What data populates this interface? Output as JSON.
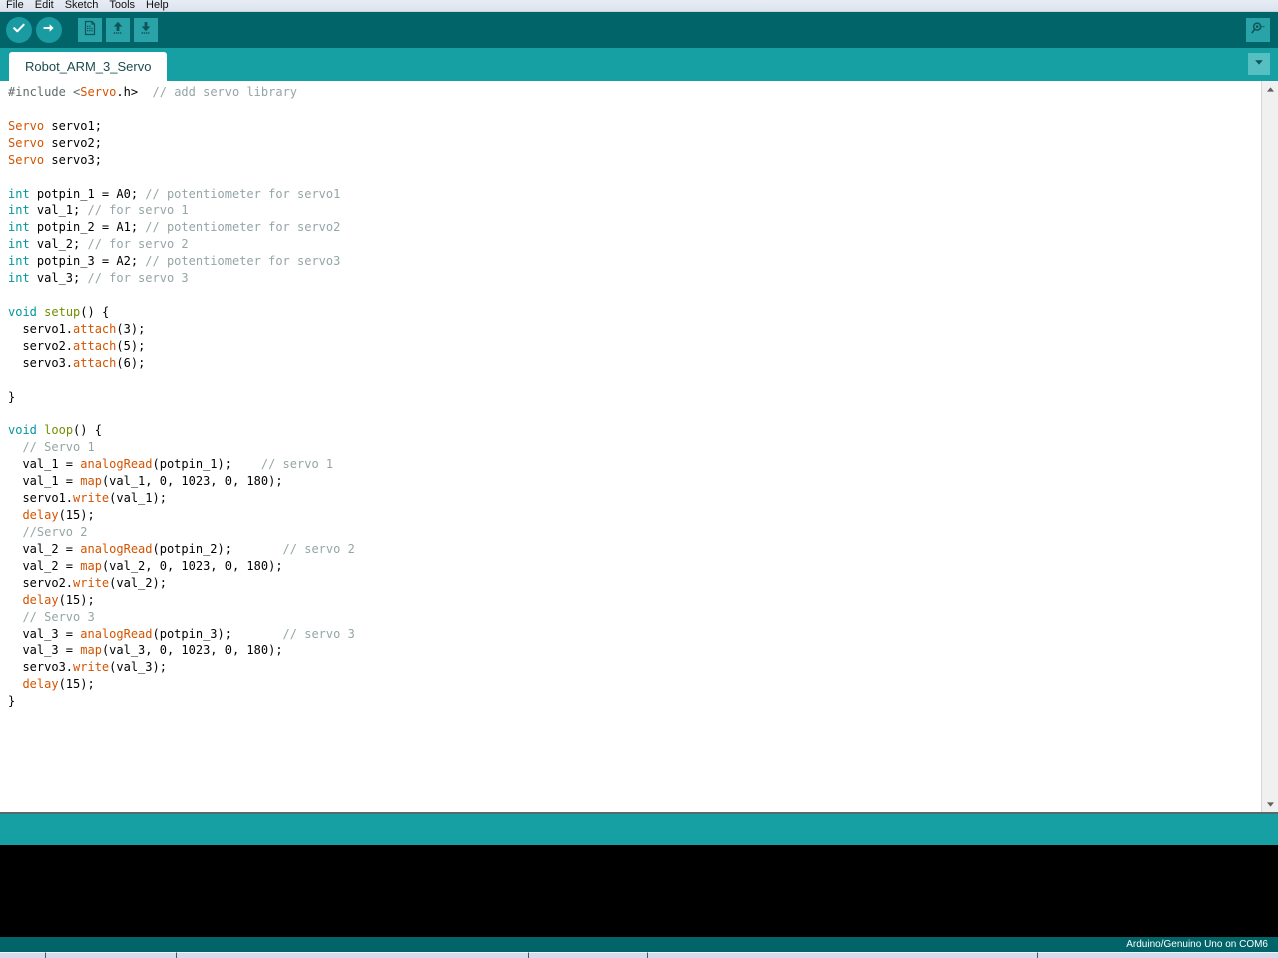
{
  "menubar": {
    "items": [
      {
        "label": "File"
      },
      {
        "label": "Edit"
      },
      {
        "label": "Sketch"
      },
      {
        "label": "Tools"
      },
      {
        "label": "Help"
      }
    ]
  },
  "toolbar": {
    "verify_label": "Verify",
    "upload_label": "Upload",
    "new_label": "New",
    "open_label": "Open",
    "save_label": "Save",
    "serial_monitor_label": "Serial Monitor"
  },
  "tabs": {
    "active": "Robot_ARM_3_Servo",
    "items": [
      {
        "label": "Robot_ARM_3_Servo"
      }
    ],
    "menu_label": "Tab Menu"
  },
  "editor": {
    "lines": [
      [
        {
          "t": "#include ",
          "c": "pp"
        },
        {
          "t": "<",
          "c": "pp"
        },
        {
          "t": "Servo",
          "c": "ty"
        },
        {
          "t": ".h>",
          "c": ""
        },
        {
          "t": "  ",
          "c": ""
        },
        {
          "t": "// add servo library",
          "c": "cm"
        }
      ],
      [],
      [
        {
          "t": "Servo",
          "c": "ty"
        },
        {
          "t": " servo1;",
          "c": ""
        }
      ],
      [
        {
          "t": "Servo",
          "c": "ty"
        },
        {
          "t": " servo2;",
          "c": ""
        }
      ],
      [
        {
          "t": "Servo",
          "c": "ty"
        },
        {
          "t": " servo3;",
          "c": ""
        }
      ],
      [],
      [
        {
          "t": "int",
          "c": "k"
        },
        {
          "t": " potpin_1 = A0; ",
          "c": ""
        },
        {
          "t": "// potentiometer for servo1",
          "c": "cm"
        }
      ],
      [
        {
          "t": "int",
          "c": "k"
        },
        {
          "t": " val_1; ",
          "c": ""
        },
        {
          "t": "// for servo 1",
          "c": "cm"
        }
      ],
      [
        {
          "t": "int",
          "c": "k"
        },
        {
          "t": " potpin_2 = A1; ",
          "c": ""
        },
        {
          "t": "// potentiometer for servo2",
          "c": "cm"
        }
      ],
      [
        {
          "t": "int",
          "c": "k"
        },
        {
          "t": " val_2; ",
          "c": ""
        },
        {
          "t": "// for servo 2",
          "c": "cm"
        }
      ],
      [
        {
          "t": "int",
          "c": "k"
        },
        {
          "t": " potpin_3 = A2; ",
          "c": ""
        },
        {
          "t": "// potentiometer for servo3",
          "c": "cm"
        }
      ],
      [
        {
          "t": "int",
          "c": "k"
        },
        {
          "t": " val_3; ",
          "c": ""
        },
        {
          "t": "// for servo 3",
          "c": "cm"
        }
      ],
      [],
      [
        {
          "t": "void",
          "c": "k"
        },
        {
          "t": " ",
          "c": ""
        },
        {
          "t": "setup",
          "c": "sf"
        },
        {
          "t": "() {",
          "c": ""
        }
      ],
      [
        {
          "t": "  servo1.",
          "c": ""
        },
        {
          "t": "attach",
          "c": "fn"
        },
        {
          "t": "(3);",
          "c": ""
        }
      ],
      [
        {
          "t": "  servo2.",
          "c": ""
        },
        {
          "t": "attach",
          "c": "fn"
        },
        {
          "t": "(5);",
          "c": ""
        }
      ],
      [
        {
          "t": "  servo3.",
          "c": ""
        },
        {
          "t": "attach",
          "c": "fn"
        },
        {
          "t": "(6);",
          "c": ""
        }
      ],
      [],
      [
        {
          "t": "}",
          "c": ""
        }
      ],
      [],
      [
        {
          "t": "void",
          "c": "k"
        },
        {
          "t": " ",
          "c": ""
        },
        {
          "t": "loop",
          "c": "sf"
        },
        {
          "t": "() {",
          "c": ""
        }
      ],
      [
        {
          "t": "  ",
          "c": ""
        },
        {
          "t": "// Servo 1",
          "c": "cm"
        }
      ],
      [
        {
          "t": "  val_1 = ",
          "c": ""
        },
        {
          "t": "analogRead",
          "c": "fn"
        },
        {
          "t": "(potpin_1);    ",
          "c": ""
        },
        {
          "t": "// servo 1",
          "c": "cm"
        }
      ],
      [
        {
          "t": "  val_1 = ",
          "c": ""
        },
        {
          "t": "map",
          "c": "fn"
        },
        {
          "t": "(val_1, 0, 1023, 0, 180);",
          "c": ""
        }
      ],
      [
        {
          "t": "  servo1.",
          "c": ""
        },
        {
          "t": "write",
          "c": "fn"
        },
        {
          "t": "(val_1);",
          "c": ""
        }
      ],
      [
        {
          "t": "  ",
          "c": ""
        },
        {
          "t": "delay",
          "c": "fn"
        },
        {
          "t": "(15);",
          "c": ""
        }
      ],
      [
        {
          "t": "  ",
          "c": ""
        },
        {
          "t": "//Servo 2",
          "c": "cm"
        }
      ],
      [
        {
          "t": "  val_2 = ",
          "c": ""
        },
        {
          "t": "analogRead",
          "c": "fn"
        },
        {
          "t": "(potpin_2);       ",
          "c": ""
        },
        {
          "t": "// servo 2",
          "c": "cm"
        }
      ],
      [
        {
          "t": "  val_2 = ",
          "c": ""
        },
        {
          "t": "map",
          "c": "fn"
        },
        {
          "t": "(val_2, 0, 1023, 0, 180);",
          "c": ""
        }
      ],
      [
        {
          "t": "  servo2.",
          "c": ""
        },
        {
          "t": "write",
          "c": "fn"
        },
        {
          "t": "(val_2);",
          "c": ""
        }
      ],
      [
        {
          "t": "  ",
          "c": ""
        },
        {
          "t": "delay",
          "c": "fn"
        },
        {
          "t": "(15);",
          "c": ""
        }
      ],
      [
        {
          "t": "  ",
          "c": ""
        },
        {
          "t": "// Servo 3",
          "c": "cm"
        }
      ],
      [
        {
          "t": "  val_3 = ",
          "c": ""
        },
        {
          "t": "analogRead",
          "c": "fn"
        },
        {
          "t": "(potpin_3);       ",
          "c": ""
        },
        {
          "t": "// servo 3",
          "c": "cm"
        }
      ],
      [
        {
          "t": "  val_3 = ",
          "c": ""
        },
        {
          "t": "map",
          "c": "fn"
        },
        {
          "t": "(val_3, 0, 1023, 0, 180);",
          "c": ""
        }
      ],
      [
        {
          "t": "  servo3.",
          "c": ""
        },
        {
          "t": "write",
          "c": "fn"
        },
        {
          "t": "(val_3);",
          "c": ""
        }
      ],
      [
        {
          "t": "  ",
          "c": ""
        },
        {
          "t": "delay",
          "c": "fn"
        },
        {
          "t": "(15);",
          "c": ""
        }
      ],
      [
        {
          "t": "}",
          "c": ""
        }
      ]
    ]
  },
  "console": {
    "text": ""
  },
  "statusbar": {
    "left_text": "",
    "board_text": "Arduino/Genuino Uno on COM6"
  },
  "colors": {
    "toolbar_bg": "#006468",
    "tabbar_bg": "#16a0a4",
    "console_bg": "#000000",
    "accent": "#00979c",
    "keyword": "#00979c",
    "function": "#d35400",
    "comment": "#95a5a6",
    "setup_loop": "#728e00"
  }
}
